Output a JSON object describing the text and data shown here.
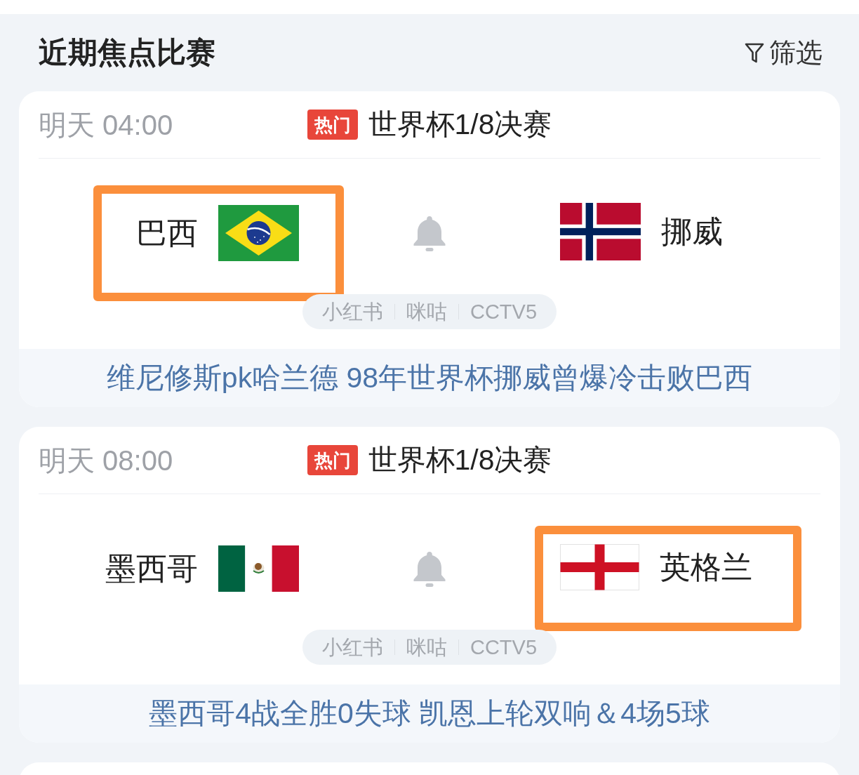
{
  "header": {
    "title": "近期焦点比赛",
    "filter_label": "筛选"
  },
  "matches": [
    {
      "time": "明天 04:00",
      "badge": "热门",
      "competition": "世界杯1/8决赛",
      "teams": [
        {
          "name": "巴西",
          "kind": "brazil",
          "highlighted": true
        },
        {
          "name": "挪威",
          "kind": "norway",
          "highlighted": false
        }
      ],
      "channels": [
        "小红书",
        "咪咕",
        "CCTV5"
      ],
      "headline": "维尼修斯pk哈兰德 98年世界杯挪威曾爆冷击败巴西"
    },
    {
      "time": "明天 08:00",
      "badge": "热门",
      "competition": "世界杯1/8决赛",
      "teams": [
        {
          "name": "墨西哥",
          "kind": "mexico",
          "highlighted": false
        },
        {
          "name": "英格兰",
          "kind": "england",
          "highlighted": true
        }
      ],
      "channels": [
        "小红书",
        "咪咕",
        "CCTV5"
      ],
      "headline": "墨西哥4战全胜0失球 凯恩上轮双响＆4场5球"
    }
  ]
}
